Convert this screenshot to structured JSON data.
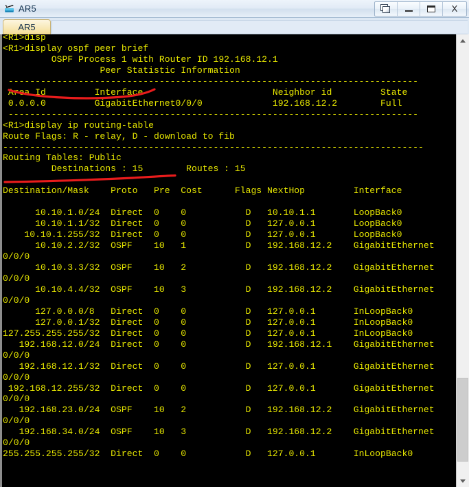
{
  "window": {
    "title": "AR5",
    "app_icon": "router-icon",
    "controls": [
      {
        "name": "restore-button",
        "icon": "restore-icon",
        "label": ""
      },
      {
        "name": "minimize-button",
        "icon": "minimize-icon",
        "label": ""
      },
      {
        "name": "maximize-button",
        "icon": "maximize-icon",
        "label": ""
      },
      {
        "name": "close-button",
        "icon": "close-icon",
        "label": "X"
      }
    ]
  },
  "tabs": [
    {
      "label": "AR5",
      "active": true
    }
  ],
  "terminal": {
    "background_color": "#000000",
    "text_color": "#e8e800",
    "prompt": "<R1>",
    "commands": [
      "display ospf peer brief",
      "display ip routing-table"
    ],
    "content": "<R1>disp\n<R1>display ospf peer brief\n\t OSPF Process 1 with Router ID 192.168.12.1\n\t\t  Peer Statistic Information\n ----------------------------------------------------------------------------\n Area Id         Interface                        Neighbor id         State\n 0.0.0.0         GigabitEthernet0/0/0             192.168.12.2        Full\n ----------------------------------------------------------------------------\n<R1>display ip routing-table\nRoute Flags: R - relay, D - download to fib\n------------------------------------------------------------------------------\nRouting Tables: Public\n         Destinations : 15        Routes : 15\n\nDestination/Mask    Proto   Pre  Cost      Flags NextHop         Interface\n\n      10.10.1.0/24  Direct  0    0           D   10.10.1.1       LoopBack0\n      10.10.1.1/32  Direct  0    0           D   127.0.0.1       LoopBack0\n    10.10.1.255/32  Direct  0    0           D   127.0.0.1       LoopBack0\n      10.10.2.2/32  OSPF    10   1           D   192.168.12.2    GigabitEthernet\n0/0/0\n      10.10.3.3/32  OSPF    10   2           D   192.168.12.2    GigabitEthernet\n0/0/0\n      10.10.4.4/32  OSPF    10   3           D   192.168.12.2    GigabitEthernet\n0/0/0\n      127.0.0.0/8   Direct  0    0           D   127.0.0.1       InLoopBack0\n      127.0.0.1/32  Direct  0    0           D   127.0.0.1       InLoopBack0\n127.255.255.255/32  Direct  0    0           D   127.0.0.1       InLoopBack0\n   192.168.12.0/24  Direct  0    0           D   192.168.12.1    GigabitEthernet\n0/0/0\n   192.168.12.1/32  Direct  0    0           D   127.0.0.1       GigabitEthernet\n0/0/0\n 192.168.12.255/32  Direct  0    0           D   127.0.0.1       GigabitEthernet\n0/0/0\n   192.168.23.0/24  OSPF    10   2           D   192.168.12.2    GigabitEthernet\n0/0/0\n   192.168.34.0/24  OSPF    10   3           D   192.168.12.2    GigabitEthernet\n0/0/0\n255.255.255.255/32  Direct  0    0           D   127.0.0.1       InLoopBack0\n",
    "ospf": {
      "process_line": "OSPF Process 1 with Router ID 192.168.12.1",
      "section_title": "Peer Statistic Information",
      "headers": [
        "Area Id",
        "Interface",
        "Neighbor id",
        "State"
      ],
      "rows": [
        [
          "0.0.0.0",
          "GigabitEthernet0/0/0",
          "192.168.12.2",
          "Full"
        ]
      ]
    },
    "routing_table": {
      "route_flags": "Route Flags: R - relay, D - download to fib",
      "tables_label": "Routing Tables: Public",
      "destinations": "15",
      "routes": "15",
      "headers": [
        "Destination/Mask",
        "Proto",
        "Pre",
        "Cost",
        "Flags",
        "NextHop",
        "Interface"
      ],
      "rows": [
        [
          "10.10.1.0/24",
          "Direct",
          "0",
          "0",
          "D",
          "10.10.1.1",
          "LoopBack0"
        ],
        [
          "10.10.1.1/32",
          "Direct",
          "0",
          "0",
          "D",
          "127.0.0.1",
          "LoopBack0"
        ],
        [
          "10.10.1.255/32",
          "Direct",
          "0",
          "0",
          "D",
          "127.0.0.1",
          "LoopBack0"
        ],
        [
          "10.10.2.2/32",
          "OSPF",
          "10",
          "1",
          "D",
          "192.168.12.2",
          "GigabitEthernet0/0/0"
        ],
        [
          "10.10.3.3/32",
          "OSPF",
          "10",
          "2",
          "D",
          "192.168.12.2",
          "GigabitEthernet0/0/0"
        ],
        [
          "10.10.4.4/32",
          "OSPF",
          "10",
          "3",
          "D",
          "192.168.12.2",
          "GigabitEthernet0/0/0"
        ],
        [
          "127.0.0.0/8",
          "Direct",
          "0",
          "0",
          "D",
          "127.0.0.1",
          "InLoopBack0"
        ],
        [
          "127.0.0.1/32",
          "Direct",
          "0",
          "0",
          "D",
          "127.0.0.1",
          "InLoopBack0"
        ],
        [
          "127.255.255.255/32",
          "Direct",
          "0",
          "0",
          "D",
          "127.0.0.1",
          "InLoopBack0"
        ],
        [
          "192.168.12.0/24",
          "Direct",
          "0",
          "0",
          "D",
          "192.168.12.1",
          "GigabitEthernet0/0/0"
        ],
        [
          "192.168.12.1/32",
          "Direct",
          "0",
          "0",
          "D",
          "127.0.0.1",
          "GigabitEthernet0/0/0"
        ],
        [
          "192.168.12.255/32",
          "Direct",
          "0",
          "0",
          "D",
          "127.0.0.1",
          "GigabitEthernet0/0/0"
        ],
        [
          "192.168.23.0/24",
          "OSPF",
          "10",
          "2",
          "D",
          "192.168.12.2",
          "GigabitEthernet0/0/0"
        ],
        [
          "192.168.34.0/24",
          "OSPF",
          "10",
          "3",
          "D",
          "192.168.12.2",
          "GigabitEthernet0/0/0"
        ],
        [
          "255.255.255.255/32",
          "Direct",
          "0",
          "0",
          "D",
          "127.0.0.1",
          "InLoopBack0"
        ]
      ]
    }
  },
  "annotations": {
    "color": "#e81c1c",
    "marks": [
      {
        "name": "underline-ospf-peer-brief",
        "target": "display ospf peer brief"
      },
      {
        "name": "underline-ip-routing-table",
        "target": "display ip routing-table"
      }
    ]
  },
  "scrollbar": {
    "up_icon": "chevron-up-icon",
    "down_icon": "chevron-down-icon",
    "orientation": "vertical"
  }
}
